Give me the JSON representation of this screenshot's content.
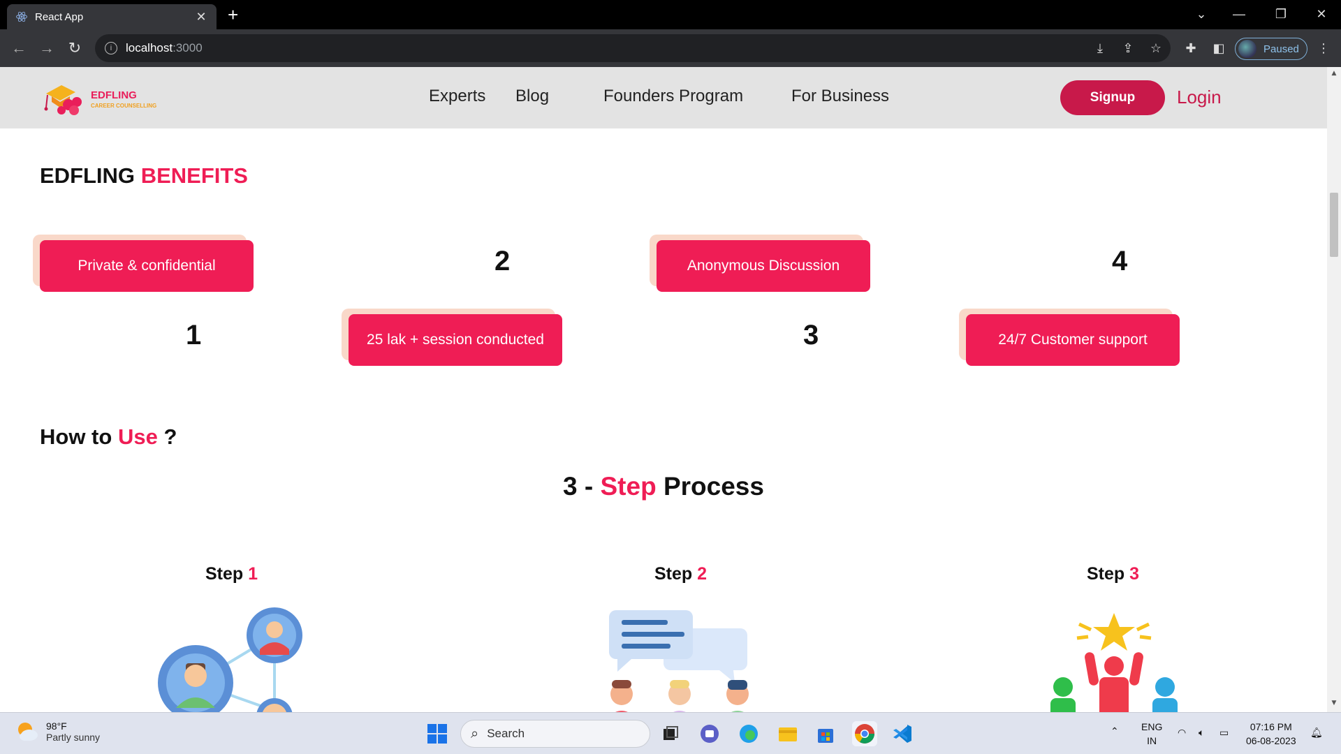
{
  "browser": {
    "tab_title": "React App",
    "tab_close": "✕",
    "new_tab": "+",
    "url_host": "localhost",
    "url_port": ":3000",
    "profile_status": "Paused"
  },
  "site": {
    "logo": {
      "name": "EDFLING",
      "tagline": "CAREER COUNSELLING"
    },
    "menu": [
      "Experts",
      "Blog",
      "Founders Program",
      "For Business"
    ],
    "signup": "Signup",
    "login": "Login"
  },
  "benefits": {
    "heading_main": "EDFLING",
    "heading_accent": "BENEFITS",
    "cards": [
      {
        "label": "Private & confidential",
        "number": "1"
      },
      {
        "label": "25 lak + session conducted",
        "number": "2"
      },
      {
        "label": "Anonymous Discussion",
        "number": "3"
      },
      {
        "label": "24/7 Customer support",
        "number": "4"
      }
    ]
  },
  "how_to_use": {
    "heading_main": "How to",
    "heading_accent": "Use",
    "heading_end": "?",
    "process_pre": "3 -",
    "process_accent": "Step",
    "process_post": "Process",
    "steps": [
      {
        "label": "Step",
        "num": "1"
      },
      {
        "label": "Step",
        "num": "2"
      },
      {
        "label": "Step",
        "num": "3"
      }
    ]
  },
  "taskbar": {
    "weather_temp": "98°F",
    "weather_desc": "Partly sunny",
    "search_label": "Search",
    "lang_1": "ENG",
    "lang_2": "IN",
    "time": "07:16 PM",
    "date": "06-08-2023"
  },
  "colors": {
    "accent": "#ef1d55",
    "signup_bg": "#c8194a",
    "nav_bg": "#e3e3e3",
    "card_shadow": "#f9d8c9"
  }
}
